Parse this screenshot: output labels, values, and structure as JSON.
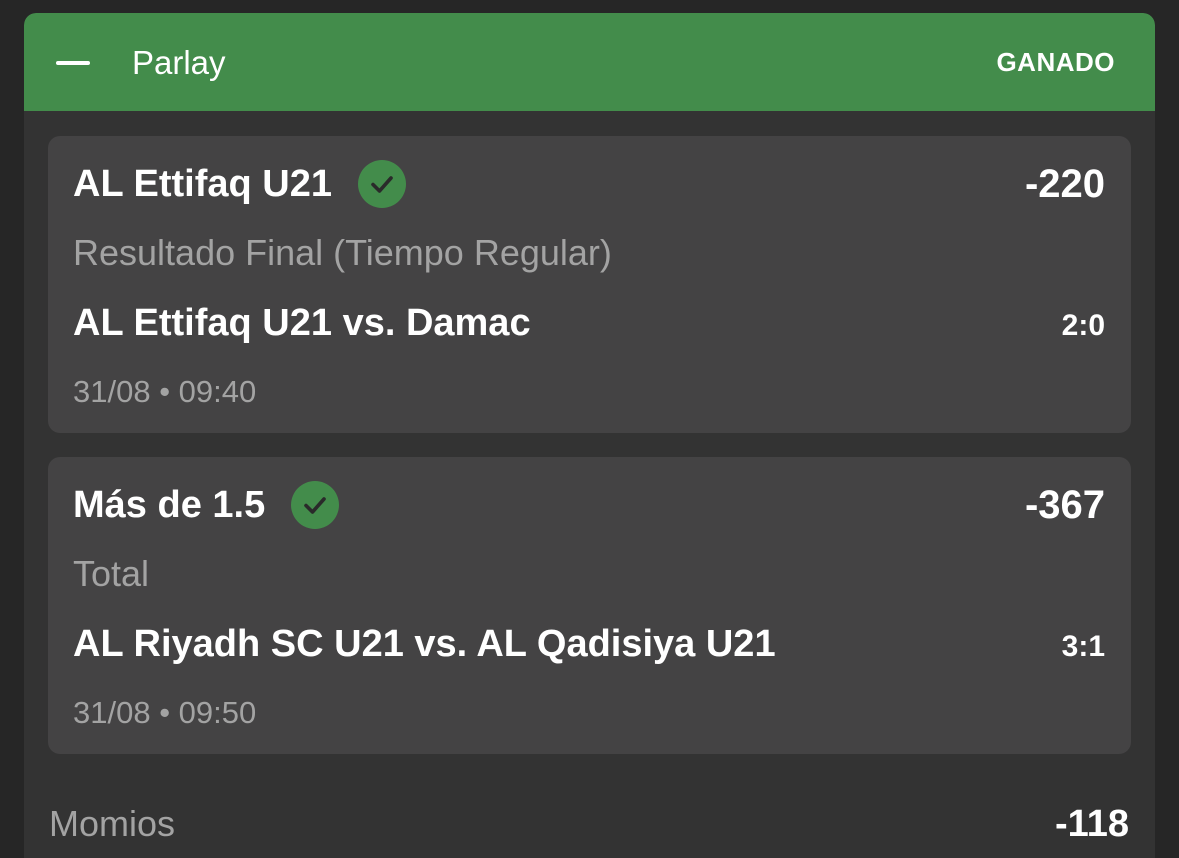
{
  "header": {
    "title": "Parlay",
    "status": "GANADO",
    "collapse_icon": "minus-icon",
    "background_color": "#438c4b"
  },
  "selections": [
    {
      "name": "AL Ettifaq U21",
      "result_icon": "check-circle-icon",
      "odds": "-220",
      "market": "Resultado Final (Tiempo Regular)",
      "match": "AL Ettifaq U21 vs. Damac",
      "score": "2:0",
      "datetime": "31/08 • 09:40"
    },
    {
      "name": "Más de 1.5",
      "result_icon": "check-circle-icon",
      "odds": "-367",
      "market": "Total",
      "match": "AL Riyadh SC U21 vs. AL Qadisiya U21",
      "score": "3:1",
      "datetime": "31/08 • 09:50"
    }
  ],
  "footer": {
    "label": "Momios",
    "value": "-118"
  },
  "colors": {
    "win_green": "#438c4b",
    "card_background": "#444344",
    "muted_text": "#a3a3a3"
  }
}
